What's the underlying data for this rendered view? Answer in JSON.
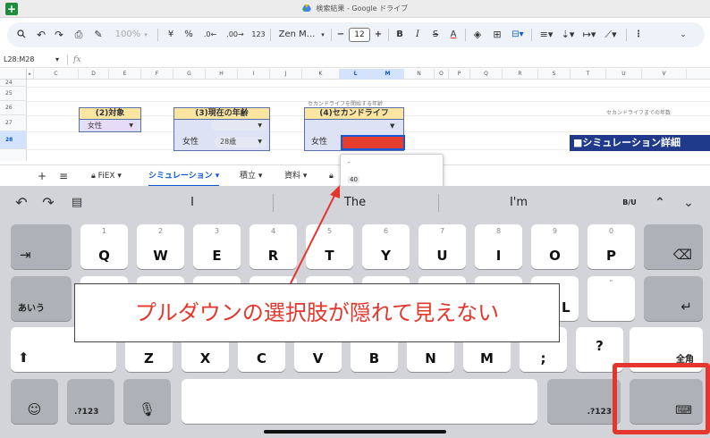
{
  "titlebar": {
    "app_icon": "+",
    "title": "検索結果 - Google ドライブ",
    "drive_icon": "google-drive-icon"
  },
  "toolbar": {
    "items": [
      "search",
      "undo",
      "redo",
      "print",
      "paint-format"
    ],
    "zoom": "100%",
    "currency": "¥",
    "percent": "%",
    "dec_decrease": ".0←",
    "dec_increase": ".00→",
    "number_format": "123",
    "font": "Zen M...",
    "font_size": "12",
    "minus": "−",
    "plus": "+",
    "bold": "B",
    "italic": "I",
    "strike": "S",
    "text_color": "A",
    "more": "⋮"
  },
  "formula": {
    "name_box": "L28:M28",
    "fx": "fx"
  },
  "grid": {
    "columns": [
      "C",
      "D",
      "E",
      "F",
      "G",
      "H",
      "I",
      "J",
      "K",
      "L",
      "M",
      "N",
      "O",
      "P",
      "Q",
      "R",
      "S",
      "T",
      "U",
      "V"
    ],
    "rows": [
      "24",
      "25",
      "26",
      "27",
      "28"
    ],
    "header_target": "(2)対象",
    "header_age": "(3)現在の年齢",
    "header_second": "(4)セカンドライフ",
    "target_value": "女性",
    "gender_label_1": "女性",
    "age_value": "28歳",
    "gender_label_2": "女性",
    "note_second": "セカンドライフを開始する年齢",
    "note_right": "セカンドライフまでの年数",
    "sim_title": "■シミュレーション詳細"
  },
  "tabs": {
    "add": "+",
    "menu": "≡",
    "items": [
      {
        "label": "FiEX",
        "locked": true
      },
      {
        "label": "シミュレーション",
        "active": true
      },
      {
        "label": "積立"
      },
      {
        "label": "資料"
      }
    ]
  },
  "dropdown": {
    "options": [
      "-",
      "40"
    ]
  },
  "keyboard": {
    "suggestions": [
      "I",
      "The",
      "I'm"
    ],
    "format_pill": "B/U",
    "row1": [
      {
        "num": "1",
        "ltr": "Q"
      },
      {
        "num": "2",
        "ltr": "W"
      },
      {
        "num": "3",
        "ltr": "E"
      },
      {
        "num": "4",
        "ltr": "R"
      },
      {
        "num": "5",
        "ltr": "T"
      },
      {
        "num": "6",
        "ltr": "Y"
      },
      {
        "num": "7",
        "ltr": "U"
      },
      {
        "num": "8",
        "ltr": "I"
      },
      {
        "num": "9",
        "ltr": "O"
      },
      {
        "num": "0",
        "ltr": "P"
      }
    ],
    "row2_visible": [
      "L"
    ],
    "row2_hint": "\"",
    "row3": [
      "Z",
      "X",
      "C",
      "V",
      "B",
      "N",
      "M"
    ],
    "row3_punct": [
      ";",
      "?"
    ],
    "kana": "あいう",
    "zenkaku": "全角",
    "num_switch": ".?123",
    "num_switch_right": ".?123"
  },
  "annotation": {
    "text": "プルダウンの選択肢が隠れて見えない"
  },
  "colors": {
    "accent": "#0b57d0",
    "callout_red": "#e4362d",
    "sheet_header_yellow": "#fbe5a0",
    "sim_title_bg": "#1f3a8a"
  }
}
